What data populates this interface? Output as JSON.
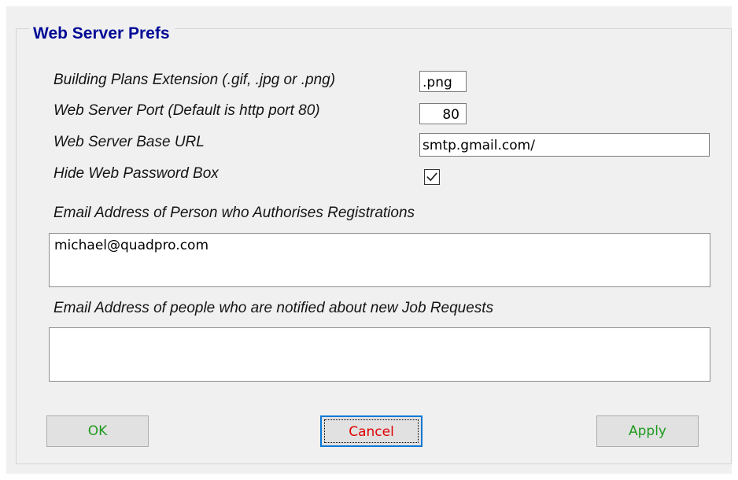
{
  "group": {
    "title": "Web Server Prefs"
  },
  "fields": {
    "plans_extension": {
      "label": "Building Plans Extension (.gif, .jpg or .png)",
      "value": ".png"
    },
    "server_port": {
      "label": "Web Server Port (Default is http port 80)",
      "value": "80"
    },
    "base_url": {
      "label": "Web Server Base URL",
      "value": "smtp.gmail.com/"
    },
    "hide_password": {
      "label": "Hide Web Password Box",
      "checked": true
    },
    "authoriser_email": {
      "label": "Email Address of Person who Authorises Registrations",
      "value": "michael@quadpro.com"
    },
    "job_request_emails": {
      "label": "Email Address of people who are notified about new Job Requests",
      "value": ""
    }
  },
  "buttons": {
    "ok": "OK",
    "cancel": "Cancel",
    "apply": "Apply"
  },
  "colors": {
    "title": "#000a96",
    "ok_apply_text": "#1f9a1f",
    "cancel_text": "#e00000",
    "focus_border": "#0a78d7"
  }
}
